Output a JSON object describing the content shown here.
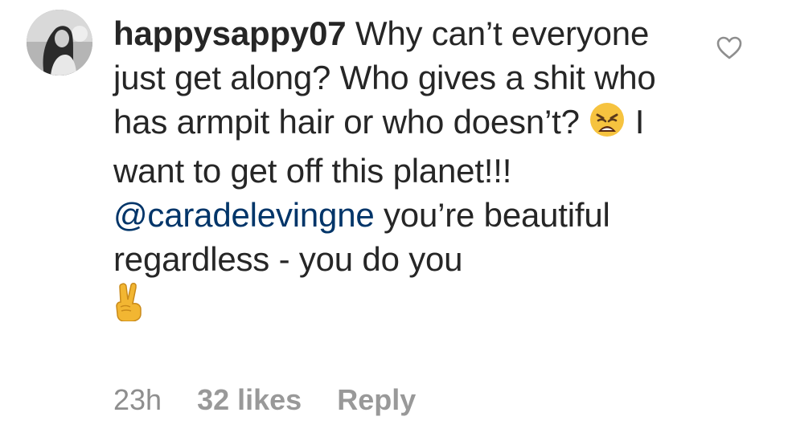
{
  "comment": {
    "username": "happysappy07",
    "text_1": "Why can’t everyone just get along? Who gives a shit who has armpit hair or who doesn’t?",
    "emoji_1": "weary-face-emoji",
    "text_2": "I want to get off this planet!!!",
    "mention": "@caradelevingne",
    "text_3": "you’re beautiful regardless - you do you",
    "emoji_2": "victory-hand-emoji",
    "time": "23h",
    "likes": "32 likes",
    "reply": "Reply"
  },
  "icons": {
    "like": "heart-outline-icon"
  },
  "colors": {
    "text": "#262626",
    "mention": "#003569",
    "meta": "#8e8e8e"
  }
}
